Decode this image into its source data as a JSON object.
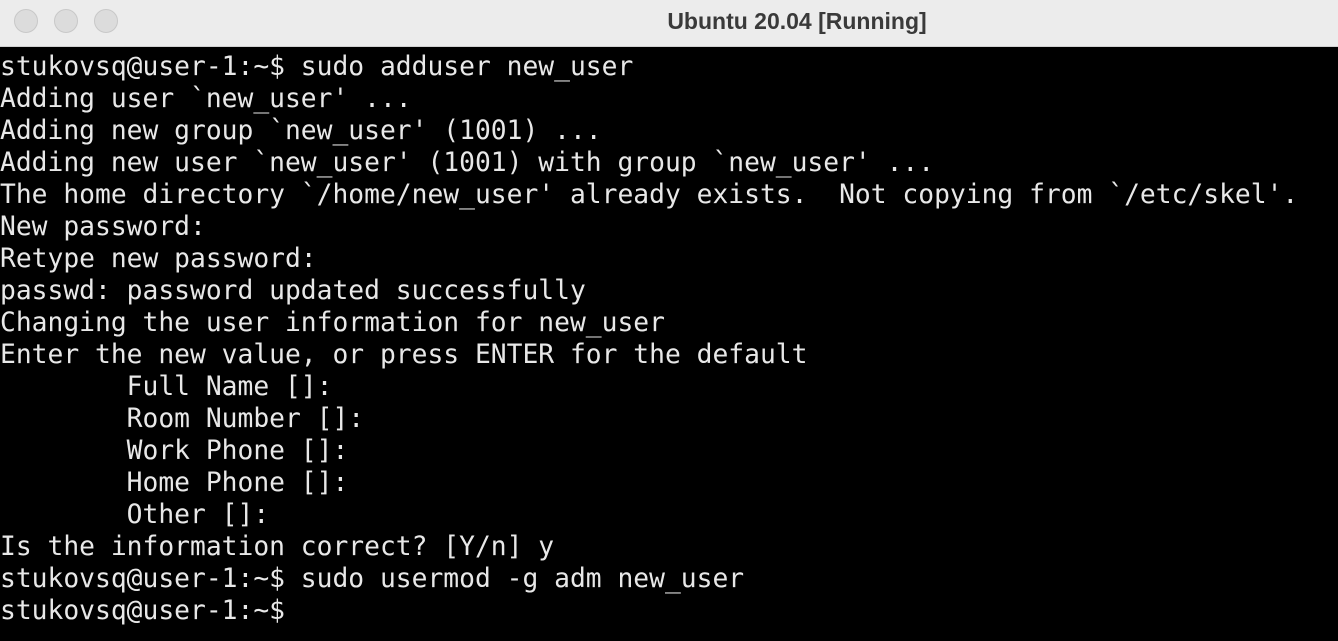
{
  "window": {
    "title": "Ubuntu 20.04 [Running]"
  },
  "terminal": {
    "lines": [
      "stukovsq@user-1:~$ sudo adduser new_user",
      "Adding user `new_user' ...",
      "Adding new group `new_user' (1001) ...",
      "Adding new user `new_user' (1001) with group `new_user' ...",
      "The home directory `/home/new_user' already exists.  Not copying from `/etc/skel'.",
      "New password:",
      "Retype new password:",
      "passwd: password updated successfully",
      "Changing the user information for new_user",
      "Enter the new value, or press ENTER for the default",
      "        Full Name []:",
      "        Room Number []:",
      "        Work Phone []:",
      "        Home Phone []:",
      "        Other []:",
      "Is the information correct? [Y/n] y",
      "stukovsq@user-1:~$ sudo usermod -g adm new_user",
      "stukovsq@user-1:~$"
    ]
  }
}
